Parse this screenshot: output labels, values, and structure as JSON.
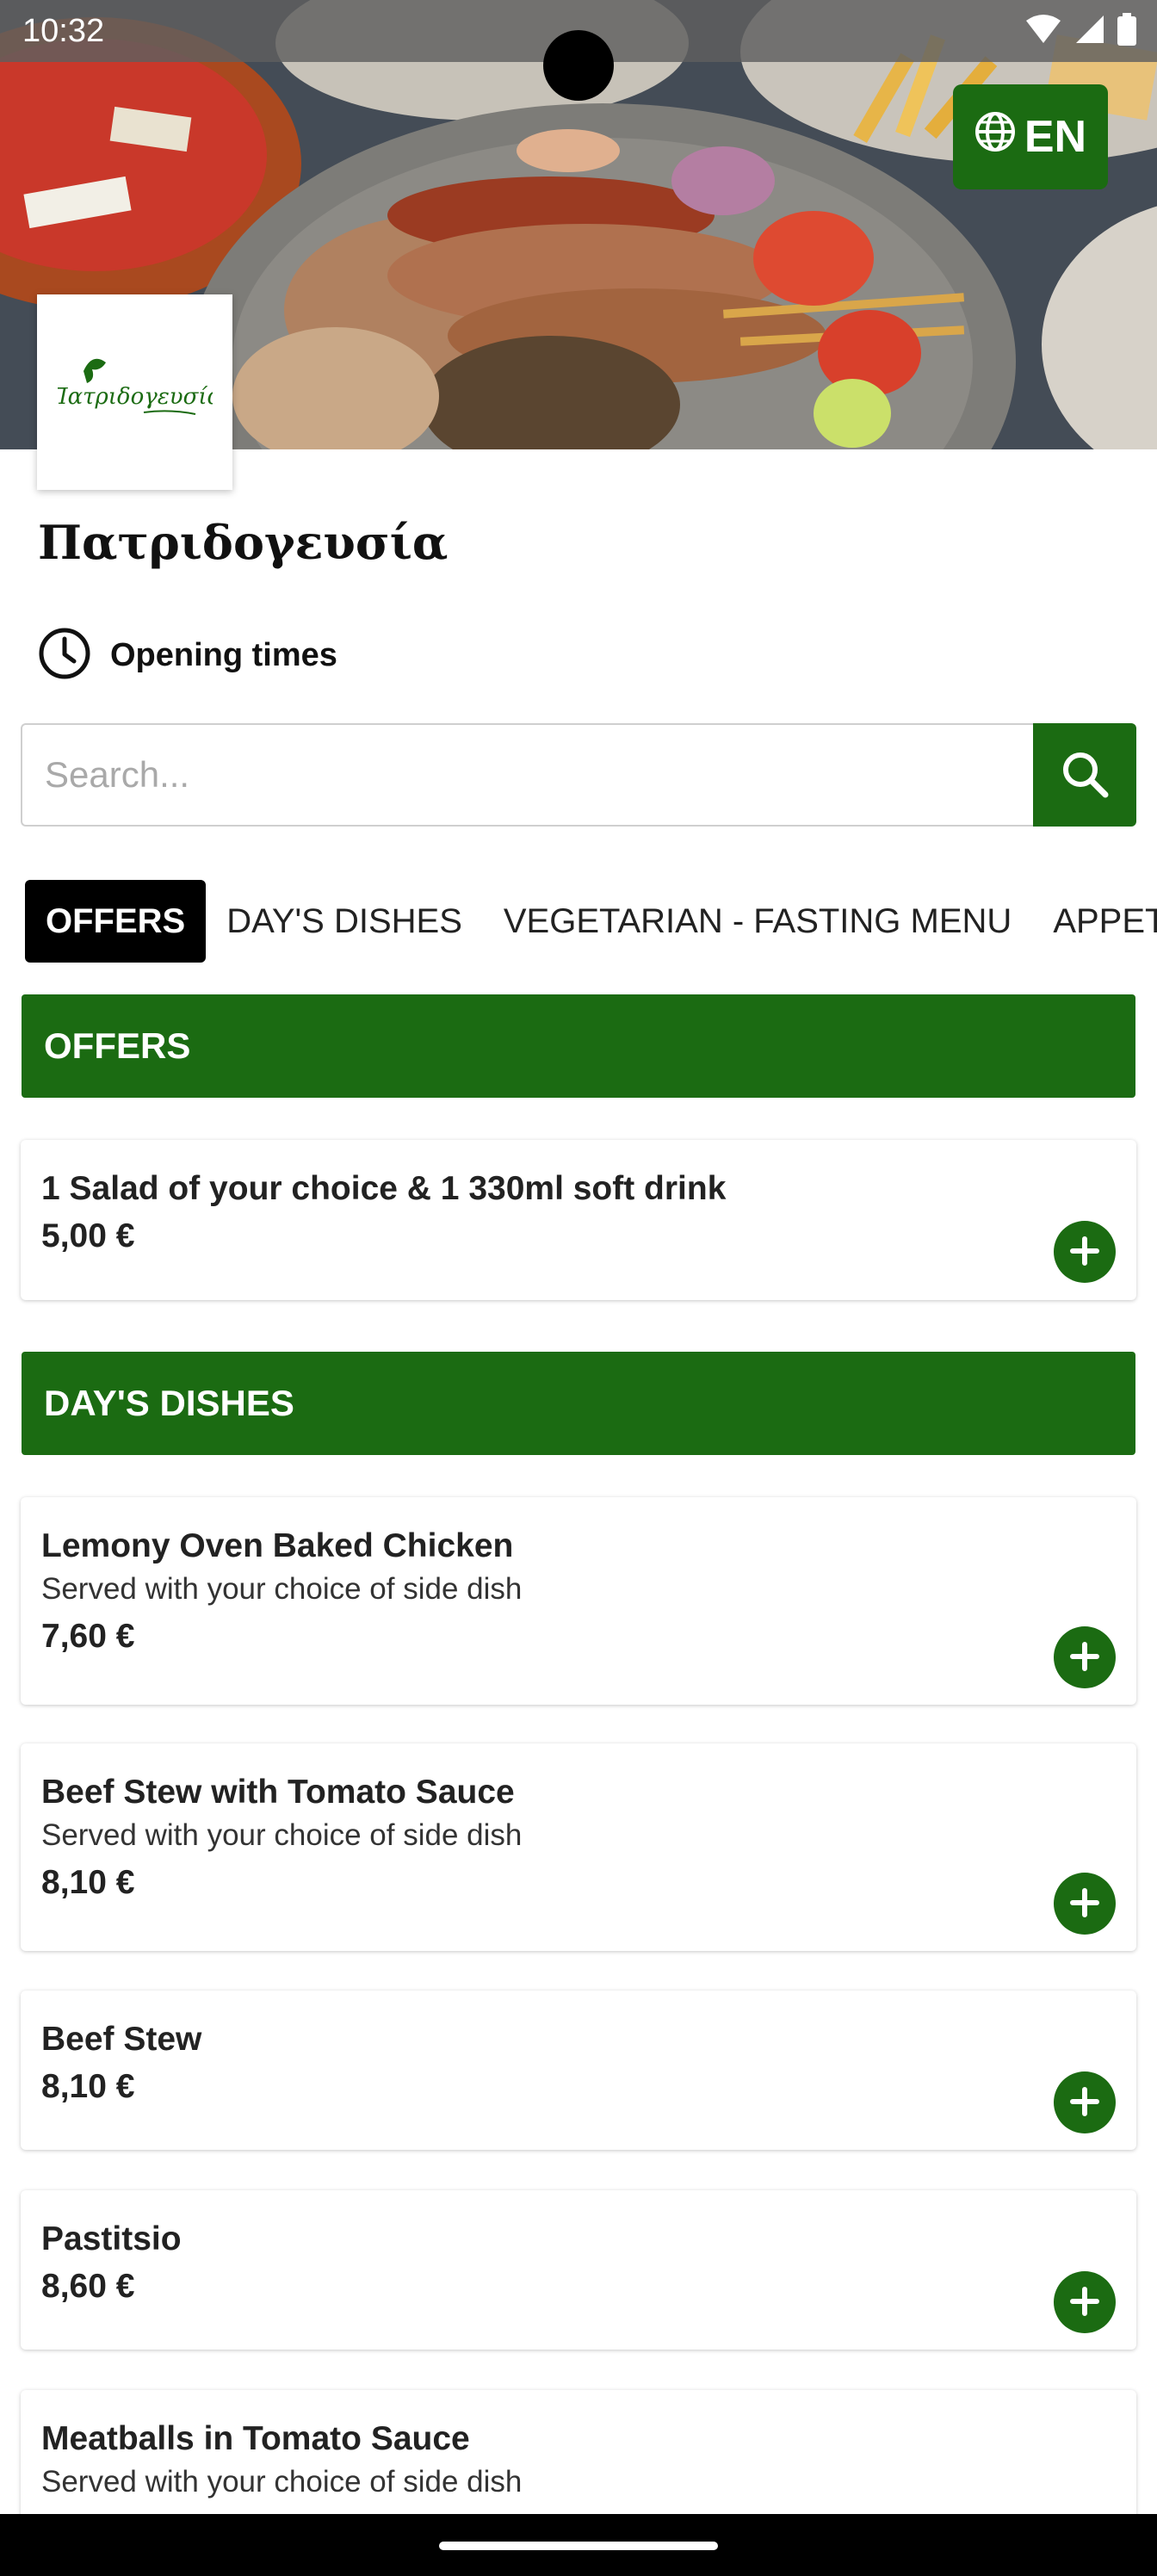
{
  "status_bar": {
    "time": "10:32"
  },
  "header": {
    "language_button": "EN",
    "restaurant_name": "Πατριδογευσία",
    "logo_text": "Πατριδογευσία",
    "opening_times_label": "Opening times"
  },
  "search": {
    "placeholder": "Search...",
    "value": ""
  },
  "tabs": [
    "OFFERS",
    "DAY'S DISHES",
    "VEGETARIAN - FASTING MENU",
    "APPET"
  ],
  "sections": [
    {
      "title": "OFFERS",
      "items": [
        {
          "name": "1 Salad of your choice & 1 330ml soft drink",
          "description": "",
          "price": "5,00 €"
        }
      ]
    },
    {
      "title": "DAY'S DISHES",
      "items": [
        {
          "name": "Lemony Oven Baked Chicken",
          "description": "Served with your choice of side dish",
          "price": "7,60 €"
        },
        {
          "name": "Beef Stew with Tomato Sauce",
          "description": "Served with your choice of side dish",
          "price": "8,10 €"
        },
        {
          "name": "Beef Stew",
          "description": "",
          "price": "8,10 €"
        },
        {
          "name": "Pastitsio",
          "description": "",
          "price": "8,60 €"
        },
        {
          "name": "Meatballs in Tomato Sauce",
          "description": "Served with your choice of side dish",
          "price": ""
        }
      ]
    }
  ],
  "colors": {
    "brand_green": "#1b6b12",
    "active_tab": "#000000"
  }
}
